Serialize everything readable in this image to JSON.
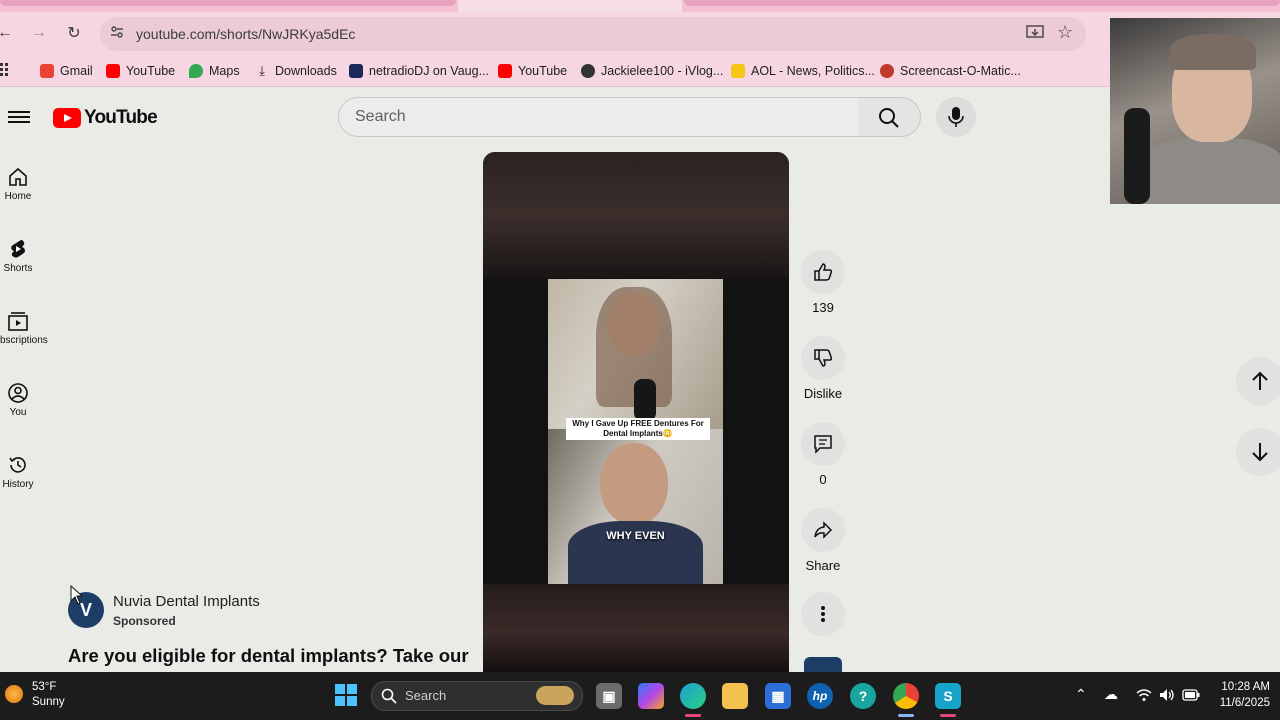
{
  "browser": {
    "url": "youtube.com/shorts/NwJRKya5dEc",
    "bookmarks": [
      {
        "label": "Gmail",
        "color": "#ea4335"
      },
      {
        "label": "YouTube",
        "color": "#ff0000"
      },
      {
        "label": "Maps",
        "color": "#34a853"
      },
      {
        "label": "Downloads",
        "color": "#202124"
      },
      {
        "label": "netradioDJ on Vaug...",
        "color": "#1a2a5a"
      },
      {
        "label": "YouTube",
        "color": "#ff0000"
      },
      {
        "label": "Jackielee100 - iVlog...",
        "color": "#333333"
      },
      {
        "label": "AOL - News, Politics...",
        "color": "#f5c518"
      },
      {
        "label": "Screencast-O-Matic...",
        "color": "#c0392b"
      }
    ]
  },
  "header": {
    "logo": "YouTube",
    "search_placeholder": "Search"
  },
  "sidebar": [
    {
      "label": "Home",
      "icon": "home-icon"
    },
    {
      "label": "Shorts",
      "icon": "shorts-icon"
    },
    {
      "label": "bscriptions",
      "icon": "subscriptions-icon"
    },
    {
      "label": "You",
      "icon": "you-icon"
    },
    {
      "label": "History",
      "icon": "history-icon"
    }
  ],
  "video": {
    "caption": "Why I Gave Up FREE Dentures For Dental Implants😳",
    "subtitle": "WHY EVEN"
  },
  "actions": {
    "like_count": "139",
    "dislike_label": "Dislike",
    "comment_count": "0",
    "share_label": "Share"
  },
  "sponsor": {
    "name": "Nuvia Dental Implants",
    "tag": "Sponsored",
    "headline": "Are you eligible for dental implants? Take our"
  },
  "taskbar": {
    "temperature": "53°F",
    "condition": "Sunny",
    "search_placeholder": "Search",
    "time": "10:28 AM",
    "date": "11/6/2025"
  },
  "colors": {
    "brand_red": "#ff0000",
    "browser_frame": "#f5d6e2"
  }
}
